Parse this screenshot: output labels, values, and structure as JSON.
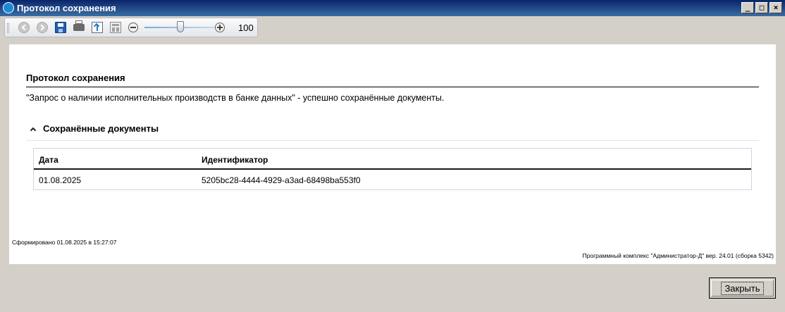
{
  "window": {
    "title": "Протокол сохранения",
    "controls": {
      "minimize": "_",
      "maximize": "□",
      "close": "×"
    }
  },
  "toolbar": {
    "icons": [
      "back-icon",
      "forward-icon",
      "save-icon",
      "print-icon",
      "export-icon",
      "layout-icon",
      "zoom-out-icon",
      "zoom-in-icon"
    ],
    "zoom_value": "100",
    "zoom_level_fraction": 0.5
  },
  "report": {
    "title": "Протокол сохранения",
    "description": "\"Запрос о наличии исполнительных производств в банке данных\" - успешно сохранённые документы.",
    "section_title": "Сохранённые документы",
    "table": {
      "headers": [
        "Дата",
        "Идентификатор"
      ],
      "rows": [
        [
          "01.08.2025",
          "5205bc28-4444-4929-a3ad-68498ba553f0"
        ]
      ]
    },
    "generated": "Сформировано 01.08.2025 в 15:27:07",
    "software": "Программный комплекс \"Администратор-Д\" вер. 24.01 (сборка 5342)"
  },
  "buttons": {
    "close": "Закрыть"
  },
  "colors": {
    "titlebar": "#0a246a",
    "window": "#d4d0c8",
    "panel": "#ffffff"
  }
}
